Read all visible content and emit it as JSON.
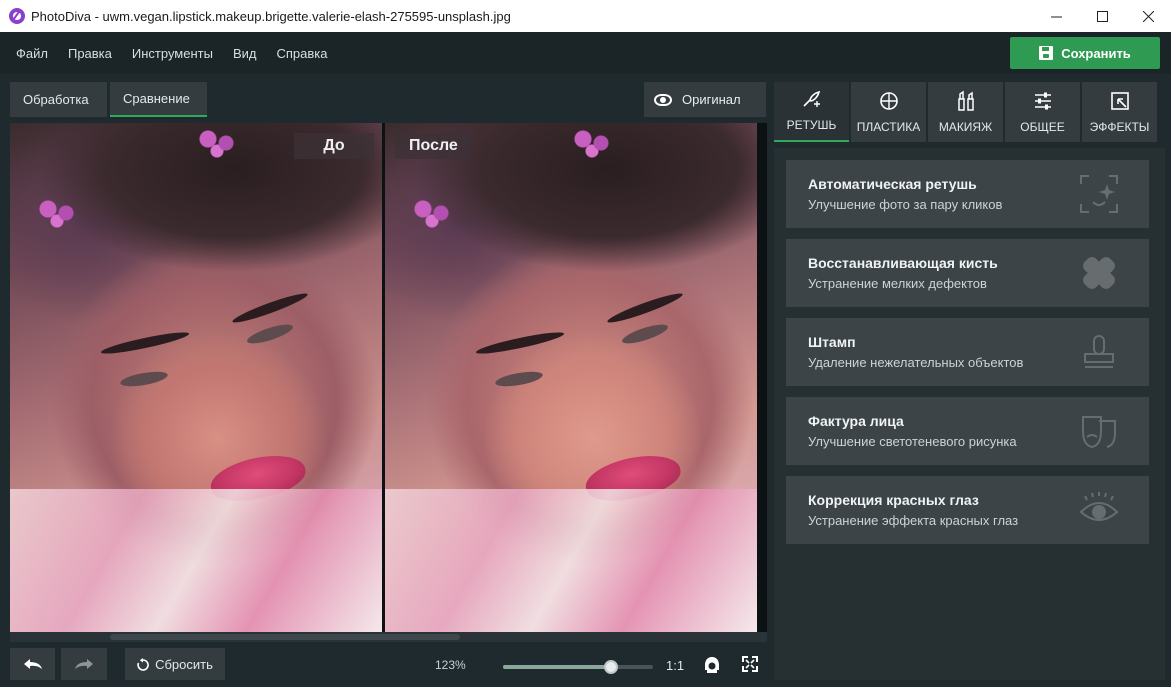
{
  "window": {
    "title": "PhotoDiva - uwm.vegan.lipstick.makeup.brigette.valerie-elash-275595-unsplash.jpg",
    "minimize_icon": "minimize-icon",
    "maximize_icon": "maximize-icon",
    "close_icon": "close-icon"
  },
  "menu": {
    "items": [
      "Файл",
      "Правка",
      "Инструменты",
      "Вид",
      "Справка"
    ],
    "save_label": "Сохранить"
  },
  "view_tabs": [
    {
      "label": "Обработка",
      "active": false
    },
    {
      "label": "Сравнение",
      "active": true
    }
  ],
  "original_label": "Оригинал",
  "compare": {
    "before_label": "До",
    "after_label": "После"
  },
  "bottom": {
    "reset_label": "Сбросить",
    "zoom_label": "123%",
    "zoom_fraction": 0.72,
    "one_to_one_label": "1:1"
  },
  "side_tabs": [
    {
      "label": "РЕТУШЬ",
      "icon": "retouch-icon",
      "active": true
    },
    {
      "label": "ПЛАСТИКА",
      "icon": "plastic-icon",
      "active": false
    },
    {
      "label": "МАКИЯЖ",
      "icon": "makeup-icon",
      "active": false
    },
    {
      "label": "ОБЩЕЕ",
      "icon": "sliders-icon",
      "active": false
    },
    {
      "label": "ЭФФЕКТЫ",
      "icon": "effects-icon",
      "active": false
    }
  ],
  "tools": [
    {
      "title": "Автоматическая ретушь",
      "desc": "Улучшение фото за пару кликов",
      "icon": "auto-retouch-icon"
    },
    {
      "title": "Восстанавливающая кисть",
      "desc": "Устранение мелких дефектов",
      "icon": "bandage-icon"
    },
    {
      "title": "Штамп",
      "desc": "Удаление нежелательных объектов",
      "icon": "stamp-icon"
    },
    {
      "title": "Фактура лица",
      "desc": "Улучшение светотеневого рисунка",
      "icon": "masks-icon"
    },
    {
      "title": "Коррекция красных глаз",
      "desc": "Устранение эффекта красных глаз",
      "icon": "eye-icon"
    }
  ],
  "colors": {
    "accent": "#32a85a",
    "save_button": "#2f9a52",
    "background": "#1f2a2e",
    "card": "#3c4447"
  }
}
